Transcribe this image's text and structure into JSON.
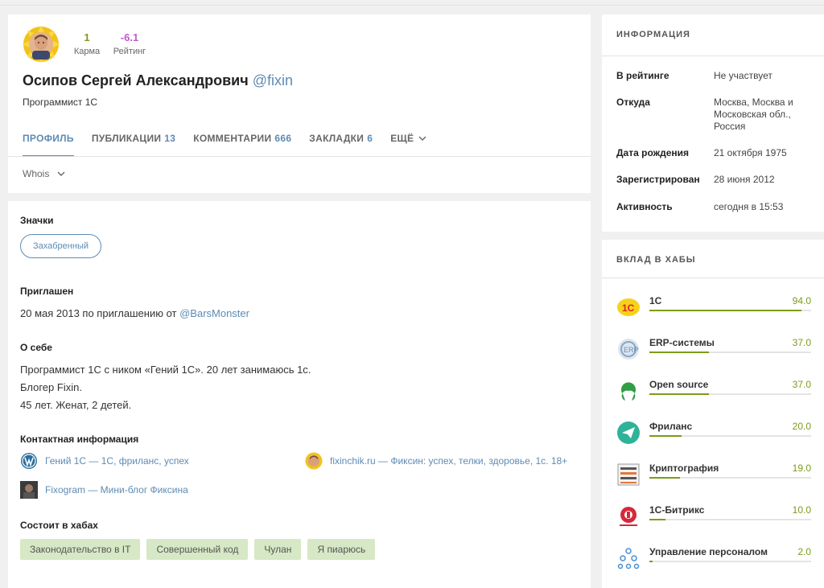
{
  "profile": {
    "karma": {
      "value": "1",
      "label": "Карма"
    },
    "rating": {
      "value": "-6.1",
      "label": "Рейтинг"
    },
    "full_name": "Осипов Сергей Александрович",
    "nickname": "@fixin",
    "specialization": "Программист 1С",
    "tabs": [
      {
        "label": "ПРОФИЛЬ",
        "count": "",
        "active": true
      },
      {
        "label": "ПУБЛИКАЦИИ",
        "count": "13",
        "active": false
      },
      {
        "label": "КОММЕНТАРИИ",
        "count": "666",
        "active": false
      },
      {
        "label": "ЗАКЛАДКИ",
        "count": "6",
        "active": false
      },
      {
        "label": "ЕЩЁ",
        "count": "",
        "active": false
      }
    ],
    "whois_label": "Whois"
  },
  "details": {
    "badges_title": "Значки",
    "badge": "Захабренный",
    "invited_title": "Приглашен",
    "invited_text": "20 мая 2013 по приглашению от ",
    "invited_by": "@BarsMonster",
    "about_title": "О себе",
    "about_lines": [
      "Программист 1С с ником «Гений 1С». 20 лет занимаюсь 1с.",
      "Блогер Fixin.",
      "45 лет. Женат, 2 детей."
    ],
    "contacts_title": "Контактная информация",
    "contacts": [
      {
        "text": "Гений 1С — 1С, фриланс, успех",
        "icon": "wordpress-icon"
      },
      {
        "text": "fixinchik.ru — Фиксин: успех, телки, здоровье, 1с. 18+",
        "icon": "avatar-sun-icon"
      },
      {
        "text": "Fixogram — Мини-блог Фиксина",
        "icon": "photo-icon"
      }
    ],
    "hubs_title": "Состоит в хабах",
    "hub_tags": [
      "Законодательство в IT",
      "Совершенный код",
      "Чулан",
      "Я пиарюсь"
    ]
  },
  "info": {
    "title": "ИНФОРМАЦИЯ",
    "rows": [
      {
        "key": "В рейтинге",
        "value": "Не участвует"
      },
      {
        "key": "Откуда",
        "value": "Москва, Москва и Московская обл., Россия"
      },
      {
        "key": "Дата рождения",
        "value": "21 октября 1975"
      },
      {
        "key": "Зарегистрирован",
        "value": "28 июня 2012"
      },
      {
        "key": "Активность",
        "value": "сегодня в 15:53"
      }
    ]
  },
  "hubs": {
    "title": "ВКЛАД В ХАБЫ",
    "items": [
      {
        "name": "1С",
        "value": "94.0",
        "fill": 0.94,
        "icon": "1c-logo-icon"
      },
      {
        "name": "ERP-системы",
        "value": "37.0",
        "fill": 0.37,
        "icon": "erp-icon"
      },
      {
        "name": "Open source",
        "value": "37.0",
        "fill": 0.37,
        "icon": "open-source-icon"
      },
      {
        "name": "Фриланс",
        "value": "20.0",
        "fill": 0.2,
        "icon": "paper-plane-icon"
      },
      {
        "name": "Криптография",
        "value": "19.0",
        "fill": 0.19,
        "icon": "crypto-icon"
      },
      {
        "name": "1С-Битрикс",
        "value": "10.0",
        "fill": 0.1,
        "icon": "bitrix-icon"
      },
      {
        "name": "Управление персоналом",
        "value": "2.0",
        "fill": 0.02,
        "icon": "people-icon"
      }
    ]
  },
  "colors": {
    "accent": "#5e8bb4",
    "karma": "#7b9c1a",
    "rating": "#c457d0",
    "hub_tag_bg": "#d6e8c5"
  }
}
